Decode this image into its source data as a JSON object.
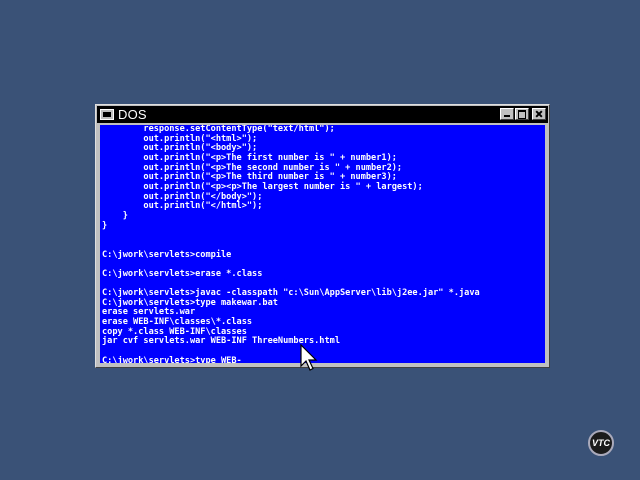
{
  "window": {
    "title": "DOS",
    "minimize_label": "minimize",
    "maximize_label": "maximize",
    "close_label": "close"
  },
  "console": {
    "lines": [
      "        response.setContentType(\"text/html\");",
      "        out.println(\"<html>\");",
      "        out.println(\"<body>\");",
      "        out.println(\"<p>The first number is \" + number1);",
      "        out.println(\"<p>The second number is \" + number2);",
      "        out.println(\"<p>The third number is \" + number3);",
      "        out.println(\"<p><p>The largest number is \" + largest);",
      "        out.println(\"</body>\");",
      "        out.println(\"</html>\");",
      "    }",
      "}",
      "",
      "",
      "C:\\jwork\\servlets>compile",
      "",
      "C:\\jwork\\servlets>erase *.class",
      "",
      "C:\\jwork\\servlets>javac -classpath \"c:\\Sun\\AppServer\\lib\\j2ee.jar\" *.java",
      "C:\\jwork\\servlets>type makewar.bat",
      "erase servlets.war",
      "erase WEB-INF\\classes\\*.class",
      "copy *.class WEB-INF\\classes",
      "jar cvf servlets.war WEB-INF ThreeNumbers.html",
      "",
      "C:\\jwork\\servlets>type WEB-_"
    ]
  },
  "logo": {
    "text": "VTC"
  }
}
